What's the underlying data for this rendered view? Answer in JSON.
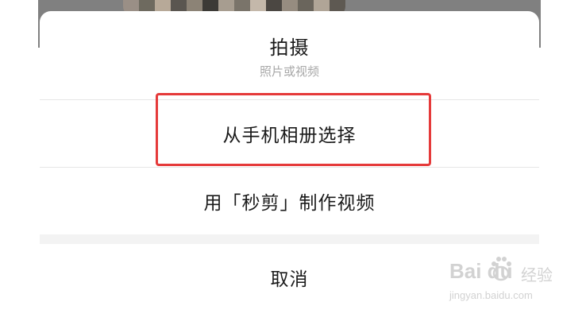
{
  "header": {
    "title": "拍摄",
    "subtitle": "照片或视频"
  },
  "options": [
    {
      "label": "从手机相册选择",
      "highlighted": true
    },
    {
      "label": "用「秒剪」制作视频",
      "highlighted": false
    }
  ],
  "cancel": {
    "label": "取消"
  },
  "watermark": {
    "brand": "Bai du",
    "suffix": "经验",
    "url": "jingyan.baidu.com"
  },
  "colors": {
    "highlight": "#e53a3a",
    "separator_gap": "#f3f3f3",
    "subtitle": "#a8a8a8"
  },
  "icons": [
    "paw-icon"
  ]
}
